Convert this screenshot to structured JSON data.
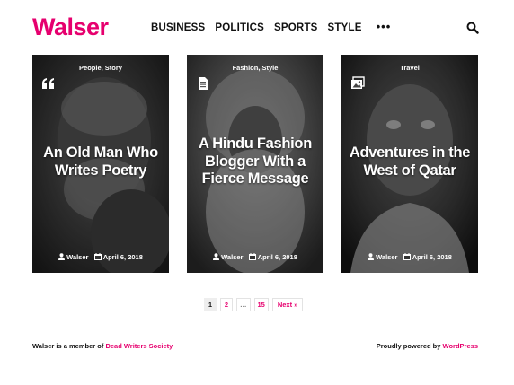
{
  "brand": {
    "name": "Walser",
    "accent": "#e6006e"
  },
  "nav": {
    "items": [
      "BUSINESS",
      "POLITICS",
      "SPORTS",
      "STYLE"
    ],
    "more": "•••"
  },
  "cards": [
    {
      "categories": "People, Story",
      "title": "An Old Man Who Writes Poetry",
      "author": "Walser",
      "date": "April 6, 2018",
      "format_icon": "quote-icon"
    },
    {
      "categories": "Fashion, Style",
      "title": "A Hindu Fashion Blogger With a Fierce Message",
      "author": "Walser",
      "date": "April 6, 2018",
      "format_icon": "document-icon"
    },
    {
      "categories": "Travel",
      "title": "Adventures in the West of Qatar",
      "author": "Walser",
      "date": "April 6, 2018",
      "format_icon": "gallery-icon"
    }
  ],
  "pagination": {
    "pages": [
      "1",
      "2",
      "…",
      "15"
    ],
    "next": "Next »"
  },
  "footer": {
    "member_prefix": "Walser is a member of",
    "member_link": "Dead Writers Society",
    "powered_prefix": "Proudly powered by",
    "powered_link": "WordPress"
  }
}
